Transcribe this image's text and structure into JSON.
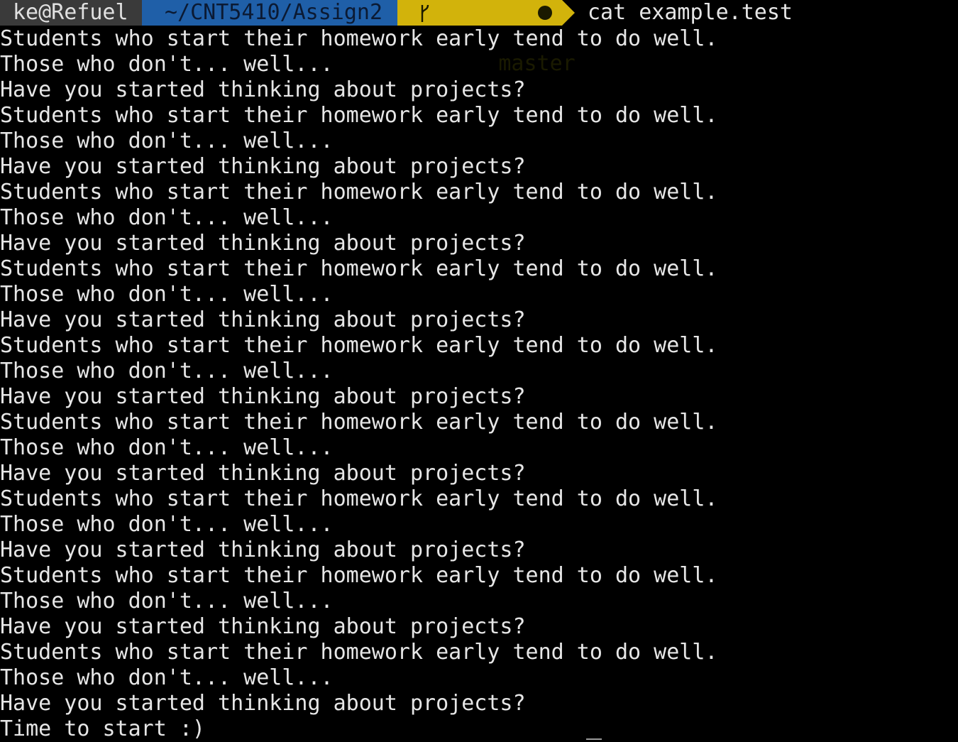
{
  "prompt": {
    "user_host": "ke@Refuel",
    "directory": "~/CNT5410/Assign2",
    "branch": "master",
    "command": "cat example.test"
  },
  "output_lines": [
    "Students who start their homework early tend to do well.",
    "Those who don't... well...",
    "Have you started thinking about projects?",
    "Students who start their homework early tend to do well.",
    "Those who don't... well...",
    "Have you started thinking about projects?",
    "Students who start their homework early tend to do well.",
    "Those who don't... well...",
    "Have you started thinking about projects?",
    "Students who start their homework early tend to do well.",
    "Those who don't... well...",
    "Have you started thinking about projects?",
    "Students who start their homework early tend to do well.",
    "Those who don't... well...",
    "Have you started thinking about projects?",
    "Students who start their homework early tend to do well.",
    "Those who don't... well...",
    "Have you started thinking about projects?",
    "Students who start their homework early tend to do well.",
    "Those who don't... well...",
    "Have you started thinking about projects?",
    "Students who start their homework early tend to do well.",
    "Those who don't... well...",
    "Have you started thinking about projects?",
    "Students who start their homework early tend to do well.",
    "Those who don't... well...",
    "Have you started thinking about projects?",
    "Time to start :)"
  ],
  "icons": {
    "branch": "git-branch-icon",
    "dirty": "dirty-state-icon"
  },
  "colors": {
    "background": "#000000",
    "text": "#e6e6e6",
    "user_segment": "#3a3a3a",
    "dir_segment": "#1f5fa8",
    "git_segment": "#d2b30b"
  }
}
